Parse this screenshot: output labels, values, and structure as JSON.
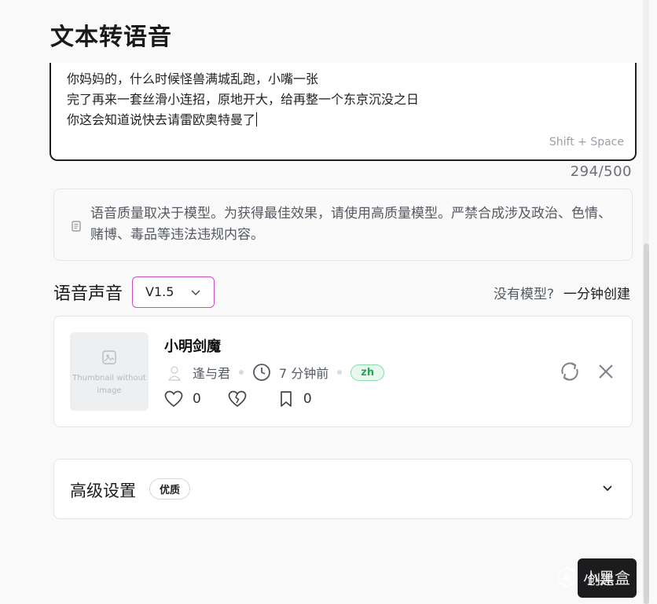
{
  "page": {
    "title": "文本转语音"
  },
  "editor": {
    "lines": [
      "你妈妈的，什么时候怪兽满城乱跑，小嘴一张",
      "完了再来一套丝滑小连招，原地开大，给再整一个东京沉没之日",
      "你这会知道说快去请雷欧奥特曼了"
    ],
    "shortcut_hint": "Shift + Space",
    "char_count": "294/500"
  },
  "notice": {
    "icon": "document-icon",
    "text": "语音质量取决于模型。为获得最佳效果，请使用高质量模型。严禁合成涉及政治、色情、赌博、毒品等违法违规内容。"
  },
  "voice": {
    "label": "语音声音",
    "version_selected": "V1.5",
    "no_model_text": "没有模型?",
    "create_link": "一分钟创建"
  },
  "model": {
    "thumbnail_text": "Thumbnail without image",
    "name": "小明剑魔",
    "author": "逢与君",
    "time_ago": "7 分钟前",
    "language": "zh",
    "likes": "0",
    "bookmarks": "0"
  },
  "advanced": {
    "title": "高级设置",
    "badge": "优质"
  },
  "create_button": {
    "label": "创建"
  },
  "watermark": {
    "text": "小黑盒"
  },
  "colors": {
    "select_border": "#c74fc3",
    "badge_green": "#2ea35c",
    "badge_green_bg": "#e8f8ee",
    "button_dark": "#1c1c1e"
  }
}
